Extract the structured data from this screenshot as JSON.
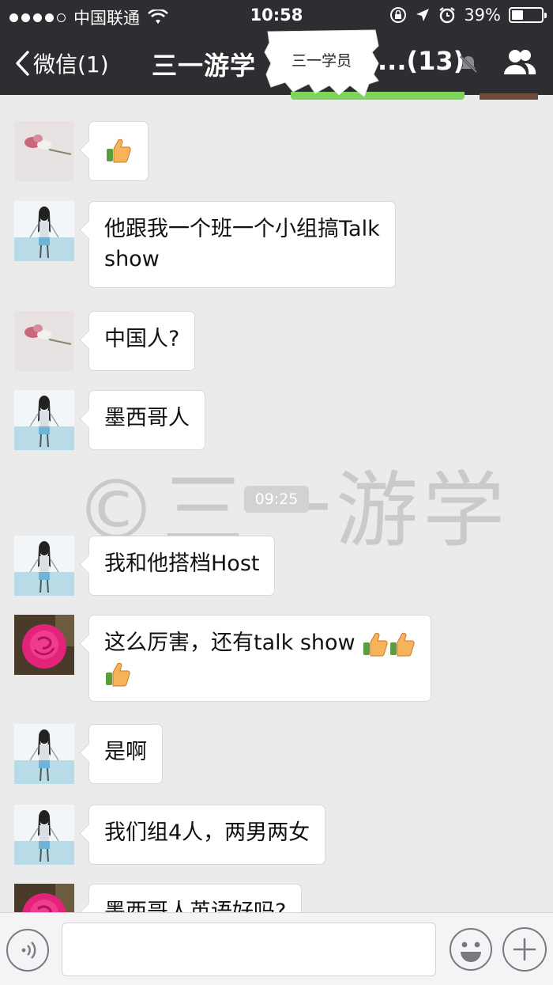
{
  "status_bar": {
    "carrier": "中国联通",
    "time": "10:58",
    "battery": "39%",
    "battery_level": 0.39
  },
  "nav": {
    "back_label": "微信(1)",
    "title": "三一游学",
    "member_count": "...(13)"
  },
  "overlay_label": "三一学员",
  "messages": [
    {
      "text": "",
      "avatar": "flower-avatar",
      "thumbs": 1
    },
    {
      "text": "他跟我一个班一个小组搞Talk\nshow",
      "avatar": "girl-avatar",
      "thumbs": 0
    },
    {
      "text": "中国人?",
      "avatar": "flower-avatar",
      "thumbs": 0
    },
    {
      "text": "墨西哥人",
      "avatar": "girl-avatar",
      "thumbs": 0
    },
    {
      "text": "我和他搭档Host",
      "avatar": "girl-avatar",
      "thumbs": 0
    },
    {
      "text": "这么厉害，还有talk show",
      "avatar": "rose-avatar",
      "thumbs": 3
    },
    {
      "text": "是啊",
      "avatar": "girl-avatar",
      "thumbs": 0
    },
    {
      "text": "我们组4人，两男两女",
      "avatar": "girl-avatar",
      "thumbs": 0
    },
    {
      "text": "墨西哥人英语好吗?",
      "avatar": "rose-avatar",
      "thumbs": 0
    }
  ],
  "timestamp": "09:25",
  "watermark": "©三一游学",
  "input": {
    "value": "",
    "placeholder": ""
  },
  "colors": {
    "nav_bg": "#2e2e32",
    "chat_bg": "#ebebeb",
    "bubble_bg": "#ffffff",
    "accent_green": "#7ed35a"
  }
}
